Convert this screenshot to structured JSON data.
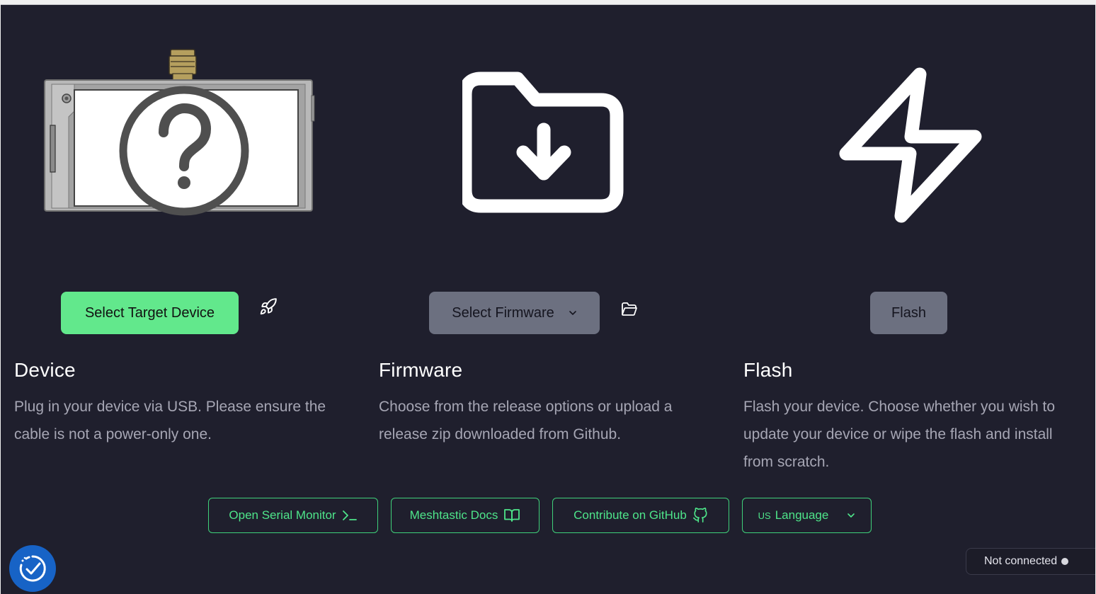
{
  "steps": [
    {
      "button_label": "Select Target Device",
      "heading": "Device",
      "description": "Plug in your device via USB. Please ensure the cable is not a power-only one.",
      "side_icon": "rocket-icon"
    },
    {
      "button_label": "Select Firmware",
      "heading": "Firmware",
      "description": "Choose from the release options or upload a release zip downloaded from Github.",
      "side_icon": "folder-open-icon"
    },
    {
      "button_label": "Flash",
      "heading": "Flash",
      "description": "Flash your device. Choose whether you wish to update your device or wipe the flash and install from scratch."
    }
  ],
  "footer": {
    "serial_monitor": "Open Serial Monitor",
    "docs": "Meshtastic Docs",
    "github": "Contribute on GitHub",
    "language_flag": "US",
    "language": "Language"
  },
  "status": {
    "text": "Not connected"
  },
  "colors": {
    "background": "#1f1f2d",
    "accent": "#62e88c",
    "muted_button": "#6c7080",
    "text_muted": "#a6a6b4",
    "accessibility": "#1763c6"
  }
}
